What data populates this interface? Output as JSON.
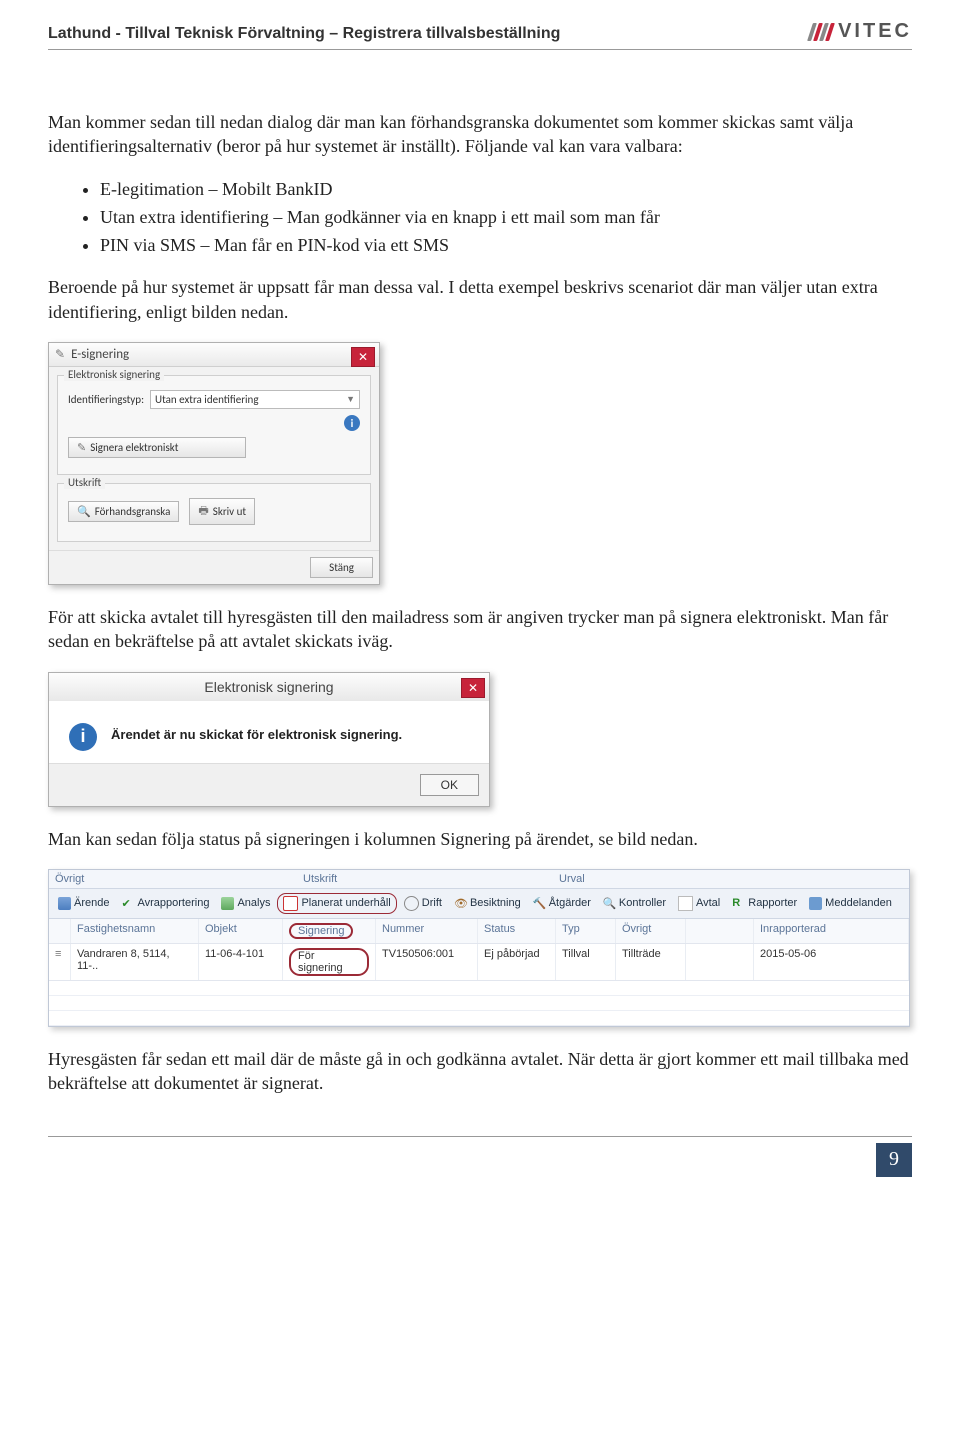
{
  "header": {
    "title": "Lathund - Tillval Teknisk Förvaltning – Registrera tillvalsbeställning",
    "brand": "VITEC"
  },
  "intro": "Man kommer sedan till nedan dialog där man kan förhandsgranska dokumentet som kommer skickas samt välja identifieringsalternativ (beror på hur systemet är inställt). Följande val kan vara valbara:",
  "bullets": [
    "E-legitimation – Mobilt BankID",
    "Utan extra identifiering – Man godkänner via en knapp i ett mail som man får",
    "PIN via SMS – Man får en PIN-kod via ett SMS"
  ],
  "para2": "Beroende på hur systemet är uppsatt får man dessa val. I detta exempel beskrivs scenariot där man väljer utan extra identifiering, enligt bilden nedan.",
  "dialog1": {
    "title": "E-signering",
    "group1": "Elektronisk signering",
    "id_label": "Identifieringstyp:",
    "id_value": "Utan extra identifiering",
    "sign_btn": "Signera elektroniskt",
    "group2": "Utskrift",
    "preview": "Förhandsgranska",
    "print": "Skriv ut",
    "close": "Stäng"
  },
  "para3": "För att skicka avtalet till hyresgästen till den mailadress som är angiven trycker man på signera elektroniskt. Man får sedan en bekräftelse på att avtalet skickats iväg.",
  "msgbox": {
    "title": "Elektronisk signering",
    "body": "Ärendet är nu skickat för elektronisk signering.",
    "ok": "OK"
  },
  "para4": "Man kan sedan följa status på signeringen i kolumnen Signering på ärendet, se bild nedan.",
  "grid": {
    "sections": {
      "ovrigt": "Övrigt",
      "utskrift": "Utskrift",
      "urval": "Urval"
    },
    "ribbon": {
      "arende": "Ärende",
      "avrapp": "Avrapportering",
      "analys": "Analys",
      "plan": "Planerat underhåll",
      "drift": "Drift",
      "besikt": "Besiktning",
      "atgard": "Åtgärder",
      "kontroll": "Kontroller",
      "avtal": "Avtal",
      "rapport": "Rapporter",
      "medd": "Meddelanden"
    },
    "columns": {
      "fastighet": "Fastighetsnamn",
      "objekt": "Objekt",
      "signering": "Signering",
      "nummer": "Nummer",
      "status": "Status",
      "typ": "Typ",
      "ovrigt": "Övrigt",
      "inrapport": "Inrapporterad"
    },
    "row": {
      "fastighet": "Vandraren 8, 5114, 11-..",
      "objekt": "11-06-4-101",
      "signering": "För signering",
      "nummer": "TV150506:001",
      "status": "Ej påbörjad",
      "typ": "Tillval",
      "ovrigt": "Tillträde",
      "inrapport": "2015-05-06"
    }
  },
  "para5": "Hyresgästen får sedan ett mail där de måste gå in och godkänna avtalet. När detta är gjort kommer ett mail tillbaka med bekräftelse att dokumentet är signerat.",
  "page_number": "9"
}
